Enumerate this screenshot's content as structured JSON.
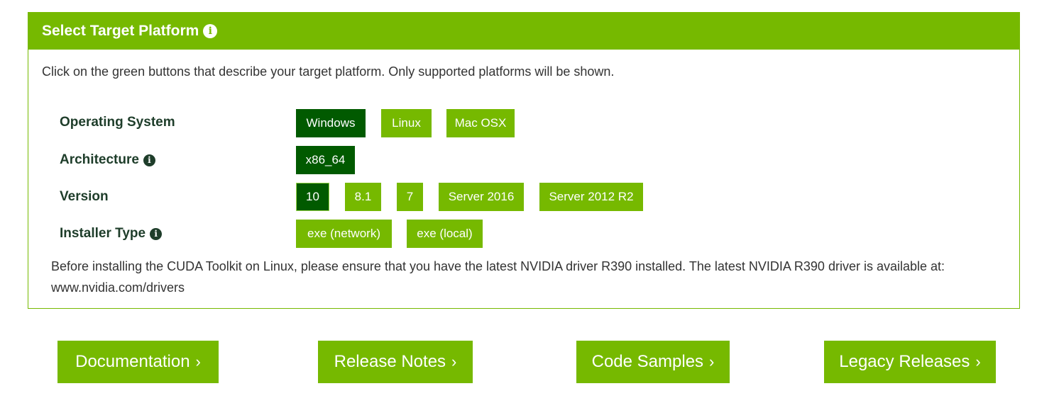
{
  "panel": {
    "title": "Select Target Platform",
    "intro": "Click on the green buttons that describe your target platform. Only supported platforms will be shown."
  },
  "rows": {
    "os": {
      "label": "Operating System",
      "options": [
        "Windows",
        "Linux",
        "Mac OSX"
      ],
      "selected": "Windows"
    },
    "arch": {
      "label": "Architecture",
      "options": [
        "x86_64"
      ],
      "selected": "x86_64"
    },
    "version": {
      "label": "Version",
      "options": [
        "10",
        "8.1",
        "7",
        "Server 2016",
        "Server 2012 R2"
      ],
      "selected": "10"
    },
    "installer": {
      "label": "Installer Type",
      "options": [
        "exe (network)",
        "exe (local)"
      ],
      "selected": null
    }
  },
  "note": "Before installing the CUDA Toolkit on Linux, please ensure that you have the latest NVIDIA driver R390 installed. The latest NVIDIA R390 driver is available at: www.nvidia.com/drivers",
  "footer_buttons": {
    "documentation": "Documentation",
    "release_notes": "Release Notes",
    "code_samples": "Code Samples",
    "legacy_releases": "Legacy Releases"
  },
  "icons": {
    "info": "info-icon",
    "chevron": "chevron-right-icon"
  },
  "colors": {
    "accent": "#76b900",
    "selected": "#015a00",
    "label": "#1e3d2a"
  }
}
